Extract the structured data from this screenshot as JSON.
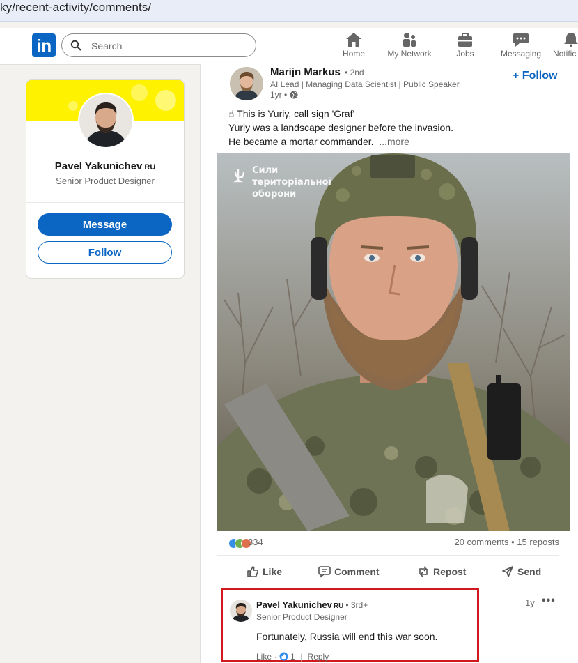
{
  "browser": {
    "url": "ky/recent-activity/comments/"
  },
  "nav": {
    "logo": "in",
    "search_placeholder": "Search",
    "items": [
      {
        "label": "Home",
        "icon": "home-icon"
      },
      {
        "label": "My Network",
        "icon": "network-icon"
      },
      {
        "label": "Jobs",
        "icon": "briefcase-icon"
      },
      {
        "label": "Messaging",
        "icon": "messaging-icon"
      },
      {
        "label": "Notific",
        "icon": "bell-icon"
      }
    ]
  },
  "profile": {
    "name": "Pavel Yakunichev",
    "country_tag": "RU",
    "title": "Senior Product Designer",
    "message_label": "Message",
    "follow_label": "Follow"
  },
  "post": {
    "author": "Marijn Markus",
    "degree": "• 2nd",
    "headline": "AI Lead | Managing Data Scientist | Public Speaker",
    "time": "1yr •",
    "follow_label": "+ Follow",
    "text_line1": "☝ This is Yuriy, call sign 'Graf'",
    "text_line2": "Yuriy was a landscape designer before the invasion.",
    "text_line3": "He became a mortar commander.",
    "more_label": "...more",
    "image_caption": "Сили територіальної оборони",
    "reactions_count": "334",
    "comments_reposts": "20 comments • 15 reposts",
    "actions": {
      "like": "Like",
      "comment": "Comment",
      "repost": "Repost",
      "send": "Send"
    }
  },
  "comment": {
    "name": "Pavel Yakunichev",
    "country_tag": "RU",
    "degree": "• 3rd+",
    "headline": "Senior Product Designer",
    "text": "Fortunately, Russia will end this war soon.",
    "time": "1y",
    "more": "•••",
    "like_label": "Like",
    "like_count": "1",
    "reply_label": "Reply"
  },
  "colors": {
    "brand": "#0a66c2",
    "highlight_border": "#d11a1f",
    "banner": "#fff200"
  }
}
